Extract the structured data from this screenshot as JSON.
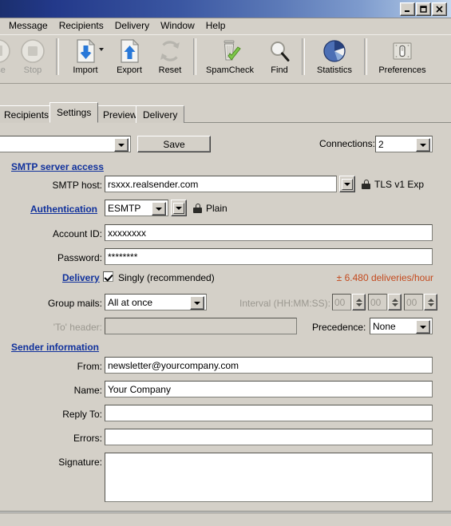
{
  "window": {
    "controls": [
      {
        "name": "resize-button",
        "glyph": "↔"
      },
      {
        "name": "minimize-button",
        "glyph": "_"
      },
      {
        "name": "maximize-button",
        "glyph": "□"
      },
      {
        "name": "close-button",
        "glyph": "✕"
      }
    ]
  },
  "menubar": {
    "items": [
      {
        "label": "Message"
      },
      {
        "label": "Recipients"
      },
      {
        "label": "Delivery"
      },
      {
        "label": "Window"
      },
      {
        "label": "Help"
      }
    ]
  },
  "toolbar": {
    "buttons": [
      {
        "label": "use",
        "icon": "pause-icon",
        "disabled": true
      },
      {
        "label": "Stop",
        "icon": "stop-icon",
        "disabled": true
      },
      {
        "label": "Import",
        "icon": "import-icon",
        "disabled": false,
        "has_dropdown": true
      },
      {
        "label": "Export",
        "icon": "export-icon",
        "disabled": false
      },
      {
        "label": "Reset",
        "icon": "reset-icon",
        "disabled": false
      },
      {
        "label": "SpamCheck",
        "icon": "spamcheck-icon",
        "disabled": false
      },
      {
        "label": "Find",
        "icon": "find-icon",
        "disabled": false
      },
      {
        "label": "Statistics",
        "icon": "statistics-icon",
        "disabled": false
      },
      {
        "label": "Preferences",
        "icon": "preferences-icon",
        "disabled": false
      }
    ]
  },
  "tabs": [
    {
      "label": "Recipients",
      "active": false
    },
    {
      "label": "Settings",
      "active": true
    },
    {
      "label": "Preview",
      "active": false
    },
    {
      "label": "Delivery",
      "active": false
    }
  ],
  "profile_bar": {
    "profile_value": "",
    "save_label": "Save",
    "connections_label": "Connections:",
    "connections_value": "2"
  },
  "smtp_section": {
    "title": "SMTP server access",
    "host_label": "SMTP host:",
    "host_value": "rsxxx.realsender.com",
    "tls_label": "TLS v1 Exp",
    "auth_label": "Authentication",
    "auth_value": "ESMTP",
    "auth_mode_label": "Plain",
    "account_label": "Account ID:",
    "account_value": "xxxxxxxx",
    "password_label": "Password:",
    "password_value": "********"
  },
  "delivery_section": {
    "delivery_label": "Delivery",
    "singly_label": "Singly (recommended)",
    "singly_checked": true,
    "rate_text": "± 6.480 deliveries/hour",
    "rate_color": "#c44a1e",
    "group_label": "Group mails:",
    "group_value": "All at once",
    "interval_label": "Interval (HH:MM:SS):",
    "interval_hh": "00",
    "interval_mm": "00",
    "interval_ss": "00",
    "to_header_label": "'To' header:",
    "to_header_value": "",
    "precedence_label": "Precedence:",
    "precedence_value": "None"
  },
  "sender_section": {
    "title": "Sender information",
    "from_label": "From:",
    "from_value": "newsletter@yourcompany.com",
    "name_label": "Name:",
    "name_value": "Your Company",
    "reply_label": "Reply To:",
    "reply_value": "",
    "errors_label": "Errors:",
    "errors_value": "",
    "signature_label": "Signature:",
    "signature_value": ""
  }
}
